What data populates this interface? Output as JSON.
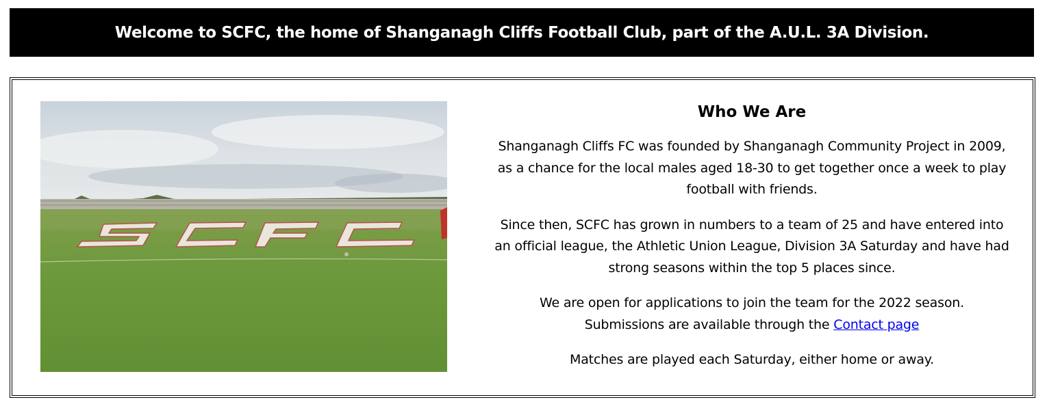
{
  "banner": {
    "text": "Welcome to SCFC, the home of Shanganagh Cliffs Football Club, part of the A.U.L. 3A Division."
  },
  "photo": {
    "pitch_lettering": "SCFC"
  },
  "about": {
    "heading": "Who We Are",
    "p1": "Shanganagh Cliffs FC was founded by Shanganagh Community Project in 2009, as a chance for the local males aged 18-30 to get together once a week to play football with friends.",
    "p2": "Since then, SCFC has grown in numbers to a team of 25 and have entered into an official league, the Athletic Union League, Division 3A Saturday and have had strong seasons within the top 5 places since.",
    "p3_line": "We are open for applications to join the team for the 2022 season.",
    "p3_prefix": "Submissions are available through the",
    "contact_link": "Contact page",
    "p4": "Matches are played each Saturday, either home or away."
  },
  "colors": {
    "banner_bg": "#000000",
    "banner_text": "#ffffff",
    "link": "#0000ee"
  }
}
